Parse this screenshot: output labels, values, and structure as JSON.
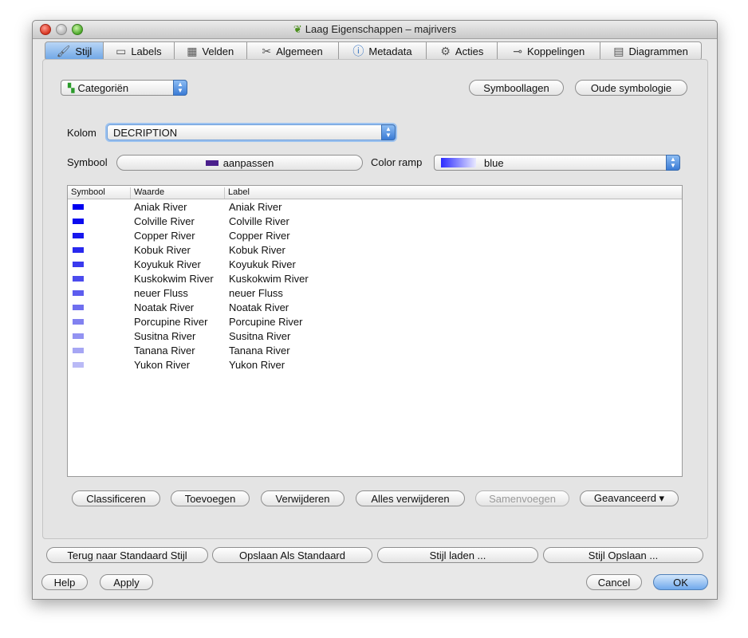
{
  "window": {
    "title": "Laag Eigenschappen – majrivers"
  },
  "tabs": [
    {
      "label": "Stijl",
      "icon": "brush-icon",
      "active": true
    },
    {
      "label": "Labels",
      "icon": "label-icon"
    },
    {
      "label": "Velden",
      "icon": "table-icon"
    },
    {
      "label": "Algemeen",
      "icon": "tools-icon"
    },
    {
      "label": "Metadata",
      "icon": "info-icon"
    },
    {
      "label": "Acties",
      "icon": "gears-icon"
    },
    {
      "label": "Koppelingen",
      "icon": "join-icon"
    },
    {
      "label": "Diagrammen",
      "icon": "diagram-icon"
    }
  ],
  "renderer": {
    "selected": "Categoriën"
  },
  "top_buttons": {
    "symbol_layers": "Symboollagen",
    "old_symbology": "Oude symbologie"
  },
  "column": {
    "label": "Kolom",
    "value": "DECRIPTION"
  },
  "symbol": {
    "label": "Symbool",
    "button": "aanpassen",
    "swatch_color": "#4a1f8c"
  },
  "color_ramp": {
    "label": "Color ramp",
    "value": "blue"
  },
  "table": {
    "headers": [
      "Symbool",
      "Waarde",
      "Label"
    ],
    "rows": [
      {
        "value": "Aniak River",
        "label": "Aniak River",
        "color": "#0000f0"
      },
      {
        "value": "Colville River",
        "label": "Colville River",
        "color": "#0b0bef"
      },
      {
        "value": "Copper River",
        "label": "Copper River",
        "color": "#1818ee"
      },
      {
        "value": "Kobuk River",
        "label": "Kobuk River",
        "color": "#2828ee"
      },
      {
        "value": "Koyukuk River",
        "label": "Koyukuk River",
        "color": "#3a3aee"
      },
      {
        "value": "Kuskokwim River",
        "label": "Kuskokwim River",
        "color": "#4b4bee"
      },
      {
        "value": "neuer Fluss",
        "label": "neuer Fluss",
        "color": "#5d5def"
      },
      {
        "value": "Noatak River",
        "label": "Noatak River",
        "color": "#6f6fef"
      },
      {
        "value": "Porcupine River",
        "label": "Porcupine River",
        "color": "#8181f0"
      },
      {
        "value": "Susitna River",
        "label": "Susitna River",
        "color": "#9393f2"
      },
      {
        "value": "Tanana River",
        "label": "Tanana River",
        "color": "#a6a6f4"
      },
      {
        "value": "Yukon River",
        "label": "Yukon River",
        "color": "#babaf6"
      }
    ]
  },
  "action_buttons": {
    "classify": "Classificeren",
    "add": "Toevoegen",
    "remove": "Verwijderen",
    "remove_all": "Alles verwijderen",
    "merge": "Samenvoegen",
    "advanced": "Geavanceerd ▾"
  },
  "style_buttons": {
    "restore_default": "Terug naar Standaard Stijl",
    "save_default": "Opslaan Als Standaard",
    "load_style": "Stijl laden ...",
    "save_style": "Stijl Opslaan ..."
  },
  "footer": {
    "help": "Help",
    "apply": "Apply",
    "cancel": "Cancel",
    "ok": "OK"
  }
}
